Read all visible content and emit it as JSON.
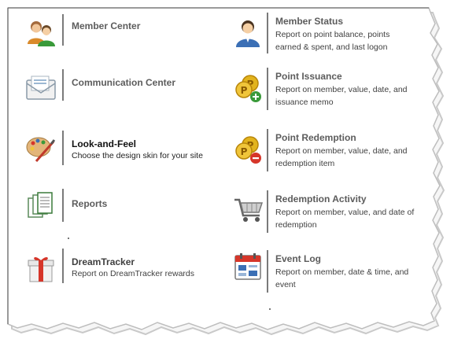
{
  "menu": {
    "items": [
      {
        "title": "Member Center",
        "description": "",
        "icon": "members-icon"
      },
      {
        "title": "Member Status",
        "description": "Report on point balance, points earned & spent, and last logon",
        "icon": "user-icon"
      },
      {
        "title": "Communication Center",
        "description": "",
        "icon": "envelope-icon"
      },
      {
        "title": "Point Issuance",
        "description": "Report on member, value, date, and issuance memo",
        "icon": "coins-plus-icon"
      },
      {
        "title": "Look-and-Feel",
        "description": "Choose the design skin for your site",
        "icon": "palette-icon"
      },
      {
        "title": "Point Redemption",
        "description": "Report on member, value, date, and redemption item",
        "icon": "coins-minus-icon"
      },
      {
        "title": "Reports",
        "description": "",
        "icon": "report-icon"
      },
      {
        "title": "Redemption Activity",
        "description": "Report on member, value, and date of redemption",
        "icon": "cart-icon"
      },
      {
        "title": "DreamTracker",
        "description": "Report on DreamTracker rewards",
        "icon": "gift-icon"
      },
      {
        "title": "Event Log",
        "description": "Report on member, date & time, and event",
        "icon": "calendar-icon"
      }
    ]
  },
  "colors": {
    "title_gray": "#5c5c5c",
    "title_dark": "#111111",
    "accent_green": "#3a9a3a",
    "accent_red": "#d6362a",
    "coin_gold": "#e2b31d"
  }
}
